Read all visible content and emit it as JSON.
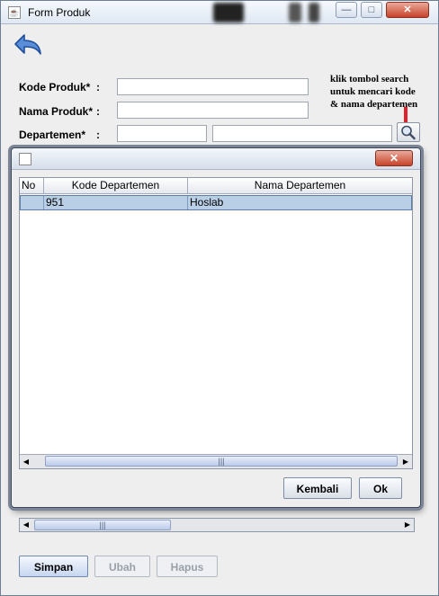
{
  "window": {
    "title": "Form Produk",
    "controls": {
      "minimize": "—",
      "maximize": "□",
      "close": "✕"
    }
  },
  "form": {
    "kode_produk": {
      "label": "Kode Produk*",
      "colon": ":",
      "value": ""
    },
    "nama_produk": {
      "label": "Nama Produk*",
      "colon": ":",
      "value": ""
    },
    "departemen": {
      "label": "Departemen*",
      "colon": ":",
      "kode_value": "",
      "nama_value": ""
    }
  },
  "note": {
    "line1": "klik tombol search",
    "line2": "untuk mencari kode",
    "line3": "& nama departemen"
  },
  "icons": {
    "back": "back-arrow-icon",
    "search": "magnifier-icon",
    "java": "java-app-icon"
  },
  "buttons": {
    "simpan": "Simpan",
    "ubah": "Ubah",
    "hapus": "Hapus"
  },
  "scroll_glyphs": {
    "left": "◀",
    "right": "▶",
    "grip": "|||"
  },
  "dialog": {
    "close": "✕",
    "columns": [
      "No",
      "Kode Departemen",
      "Nama Departemen"
    ],
    "rows": [
      {
        "no": "",
        "kode": "951",
        "nama": "Hoslab"
      }
    ],
    "buttons": {
      "kembali": "Kembali",
      "ok": "Ok"
    }
  },
  "colors": {
    "selected_row": "#b8cfe5",
    "close_button": "#c7432a",
    "red_marker": "#e0202a"
  }
}
